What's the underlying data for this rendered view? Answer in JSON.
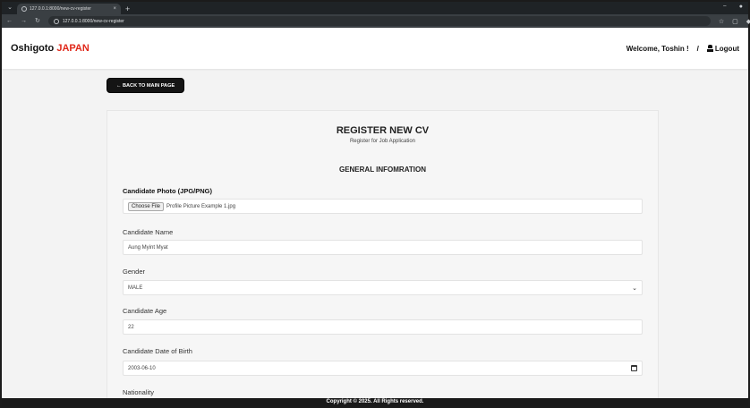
{
  "browser": {
    "tab_title": "127.0.0.1:8000/new-cv-register",
    "tab_close": "×",
    "new_tab": "+",
    "url": "127.0.0.1:8000/new-cv-register",
    "minimize": "−",
    "maximize": "□",
    "close": "×"
  },
  "navbar": {
    "brand_main": "Oshigoto",
    "brand_accent": "JAPAN",
    "welcome": "Welcome, Toshin !",
    "separator": "/",
    "logout": "Logout"
  },
  "back_button": "← BACK TO MAIN PAGE",
  "form": {
    "title": "REGISTER NEW CV",
    "subtitle": "Register for Job Application",
    "section": "GENERAL INFOMRATION",
    "photo_label": "Candidate Photo (JPG/PNG)",
    "photo_button": "Choose File",
    "photo_value": "Profile Picture Example 1.jpg",
    "name_label": "Candidate Name",
    "name_value": "Aung Myint Myat",
    "gender_label": "Gender",
    "gender_value": "MALE",
    "age_label": "Candidate Age",
    "age_value": "22",
    "dob_label": "Candidate Date of Birth",
    "dob_value": "2003-06-10",
    "nationality_label": "Nationality"
  },
  "footer": "Copyright © 2025. All Rights reserved.",
  "colors": {
    "accent": "#e0281a",
    "dark": "#141414"
  }
}
